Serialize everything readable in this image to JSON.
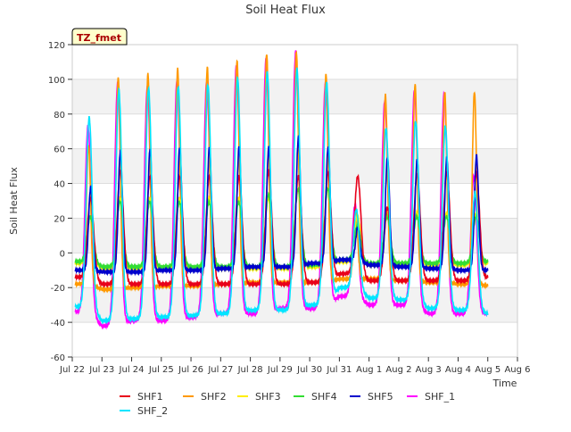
{
  "chart_data": {
    "type": "line",
    "title": "Soil Heat Flux",
    "xlabel": "Time",
    "ylabel": "Soil Heat Flux",
    "site_label": "TZ_fmet",
    "xlim": [
      0,
      15
    ],
    "ylim": [
      -60,
      120
    ],
    "yticks": [
      -60,
      -40,
      -20,
      0,
      20,
      40,
      60,
      80,
      100,
      120
    ],
    "xtick_labels": [
      "Jul 22",
      "Jul 23",
      "Jul 24",
      "Jul 25",
      "Jul 26",
      "Jul 27",
      "Jul 28",
      "Jul 29",
      "Jul 30",
      "Jul 31",
      "Aug 1",
      "Aug 2",
      "Aug 3",
      "Aug 4",
      "Aug 5",
      "Aug 6"
    ],
    "grid": "horizontal bands",
    "legend_position": "bottom",
    "series": [
      {
        "name": "SHF1",
        "color": "#e8001a",
        "peaks": [
          30,
          45,
          42,
          42,
          42,
          42,
          45,
          42,
          44,
          42,
          25,
          43,
          44,
          44,
          15
        ],
        "troughs": [
          -14,
          -18,
          -18,
          -18,
          -18,
          -18,
          -18,
          -18,
          -17,
          -12,
          -16,
          -16,
          -16,
          -16,
          -14
        ]
      },
      {
        "name": "SHF2",
        "color": "#ff9900",
        "peaks": [
          62,
          101,
          103,
          106,
          107,
          111,
          115,
          116,
          103,
          25,
          91,
          97,
          93,
          93,
          16
        ],
        "troughs": [
          -18,
          -21,
          -20,
          -19,
          -19,
          -18,
          -17,
          -17,
          -17,
          -15,
          -15,
          -16,
          -17,
          -18,
          -19
        ]
      },
      {
        "name": "SHF3",
        "color": "#ffee00",
        "peaks": [
          20,
          30,
          30,
          30,
          30,
          30,
          30,
          35,
          35,
          20,
          22,
          22,
          22,
          22,
          12
        ],
        "troughs": [
          -6,
          -9,
          -9,
          -9,
          -9,
          -9,
          -9,
          -9,
          -8,
          -5,
          -7,
          -7,
          -7,
          -7,
          -6
        ]
      },
      {
        "name": "SHF4",
        "color": "#33dd33",
        "peaks": [
          20,
          28,
          28,
          28,
          28,
          28,
          32,
          35,
          35,
          15,
          20,
          20,
          20,
          20,
          12
        ],
        "troughs": [
          -5,
          -8,
          -8,
          -8,
          -8,
          -8,
          -8,
          -8,
          -7,
          -4,
          -6,
          -6,
          -6,
          -6,
          -5
        ]
      },
      {
        "name": "SHF5",
        "color": "#0000cc",
        "peaks": [
          38,
          58,
          60,
          61,
          61,
          61,
          61,
          67,
          61,
          15,
          55,
          54,
          55,
          56,
          9
        ],
        "troughs": [
          -10,
          -11,
          -11,
          -10,
          -10,
          -9,
          -8,
          -8,
          -6,
          -4,
          -7,
          -8,
          -9,
          -10,
          -10
        ]
      },
      {
        "name": "SHF_1",
        "color": "#ff00ff",
        "peaks": [
          73,
          98,
          96,
          100,
          99,
          108,
          112,
          116,
          98,
          28,
          88,
          94,
          92,
          44,
          40
        ],
        "troughs": [
          -34,
          -42,
          -39,
          -39,
          -37,
          -35,
          -35,
          -32,
          -32,
          -25,
          -30,
          -30,
          -35,
          -35,
          -35
        ]
      },
      {
        "name": "SHF_2",
        "color": "#00e5ff",
        "peaks": [
          78,
          94,
          95,
          96,
          97,
          101,
          104,
          106,
          98,
          25,
          72,
          76,
          73,
          35,
          30
        ],
        "troughs": [
          -31,
          -39,
          -38,
          -37,
          -36,
          -35,
          -33,
          -33,
          -30,
          -20,
          -26,
          -27,
          -32,
          -33,
          -35
        ]
      }
    ]
  }
}
